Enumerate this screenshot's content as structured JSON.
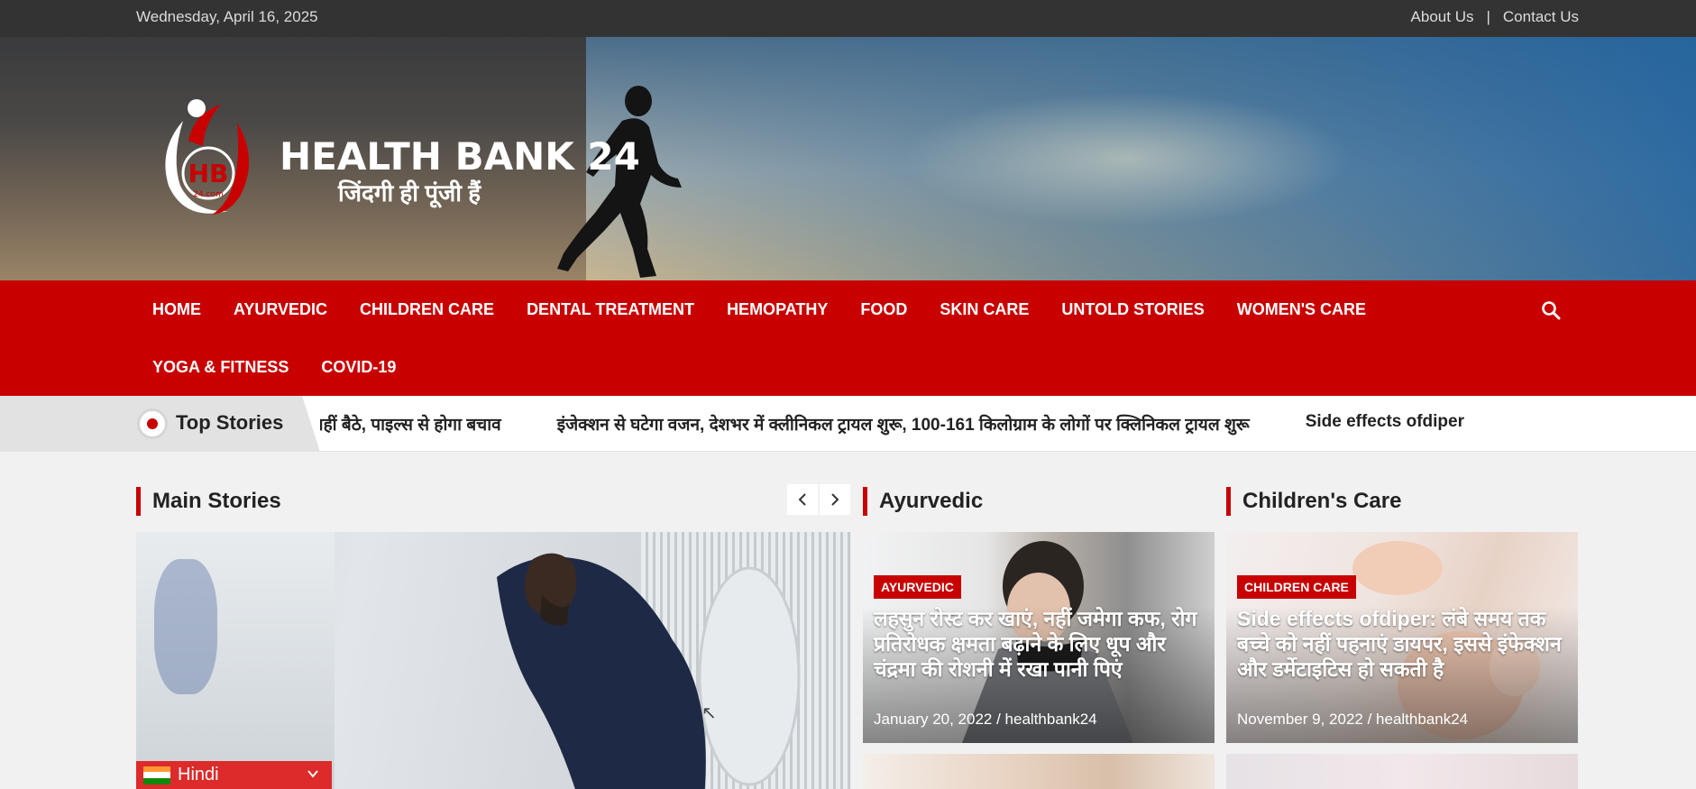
{
  "topbar": {
    "date": "Wednesday, April 16, 2025",
    "links": [
      "About Us",
      "Contact Us"
    ],
    "separator": "|"
  },
  "brand": {
    "title": "HEALTH BANK 24",
    "tagline": "जिंदगी ही पूंजी हैं",
    "logo_text": "HB",
    "logo_sub": "24.com",
    "accent": "#c80000"
  },
  "nav": {
    "items": [
      "HOME",
      "AYURVEDIC",
      "CHILDREN CARE",
      "DENTAL TREATMENT",
      "HEMOPATHY",
      "FOOD",
      "SKIN CARE",
      "UNTOLD STORIES",
      "WOMEN'S CARE",
      "YOGA & FITNESS",
      "COVID-19"
    ],
    "search_icon": "search-icon"
  },
  "ticker": {
    "title": "Top Stories",
    "items": [
      "र नहीं बैठे, पाइल्स से होगा बचाव",
      "इंजेक्शन से घटेगा वजन, देशभर में क्लीनिकल ट्रायल शुरू,  100-161 किलोग्राम के लोगों पर क्लिनिकल ट्रायल शुरू",
      "Side effects ofdiper"
    ]
  },
  "sections": {
    "main": "Main Stories",
    "ayurvedic": "Ayurvedic",
    "children": "Children's Care"
  },
  "cards": {
    "ayurvedic": {
      "badge": "AYURVEDIC",
      "headline": "लहसुन रोस्ट कर खाएं, नहीं जमेगा कफ, रोग प्रतिरोधक क्षमता बढ़ाने के लिए धूप और चंद्रमा की रोशनी में रखा पानी पिएं",
      "meta": "January 20, 2022 / healthbank24"
    },
    "children": {
      "badge": "CHILDREN CARE",
      "headline": "Side effects ofdiper: लंबे समय तक बच्चे को नहीं पहनाएं डायपर, इससे इंफेक्शन और डर्मेटाइटिस हो सकती है",
      "meta": "November 9, 2022 / healthbank24"
    }
  },
  "language": {
    "selected": "Hindi"
  }
}
